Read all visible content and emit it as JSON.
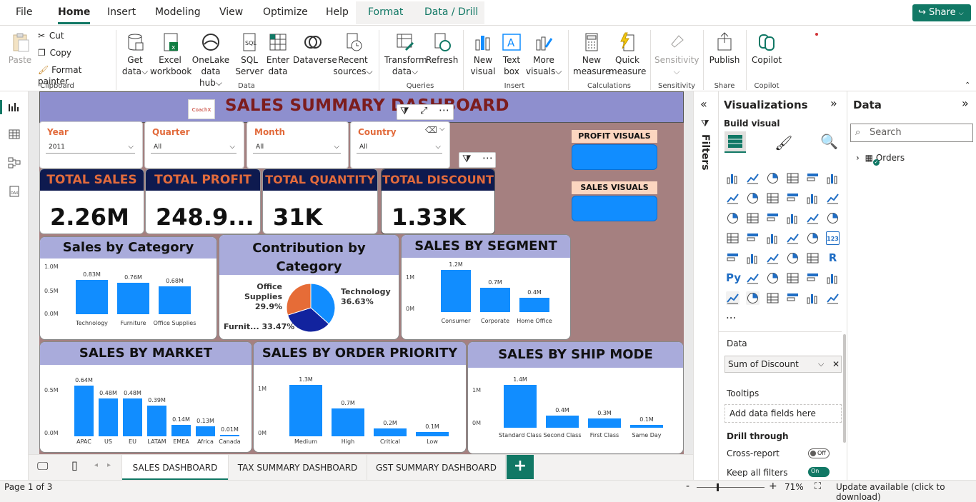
{
  "menu": {
    "tabs": [
      "File",
      "Home",
      "Insert",
      "Modeling",
      "View",
      "Optimize",
      "Help",
      "Format",
      "Data / Drill"
    ],
    "share_label": "Share"
  },
  "ribbon": {
    "clipboard": {
      "paste": "Paste",
      "cut": "Cut",
      "copy": "Copy",
      "format_painter": "Format painter",
      "group": "Clipboard"
    },
    "data": {
      "get_data": [
        "Get",
        "data"
      ],
      "excel": [
        "Excel",
        "workbook"
      ],
      "onelake": [
        "OneLake",
        "data hub"
      ],
      "sql": [
        "SQL",
        "Server"
      ],
      "enter": [
        "Enter",
        "data"
      ],
      "dataverse": "Dataverse",
      "recent": [
        "Recent",
        "sources"
      ],
      "group": "Data"
    },
    "queries": {
      "transform": [
        "Transform",
        "data"
      ],
      "refresh": "Refresh",
      "group": "Queries"
    },
    "insert": {
      "new_visual": [
        "New",
        "visual"
      ],
      "text_box": [
        "Text",
        "box"
      ],
      "more_visuals": [
        "More",
        "visuals"
      ],
      "group": "Insert"
    },
    "calculations": {
      "new_measure": [
        "New",
        "measure"
      ],
      "quick_measure": [
        "Quick",
        "measure"
      ],
      "group": "Calculations"
    },
    "sensitivity": {
      "label": "Sensitivity",
      "group": "Sensitivity"
    },
    "share": {
      "publish": "Publish",
      "group": "Share"
    },
    "copilot": {
      "label": "Copilot",
      "group": "Copilot"
    }
  },
  "report": {
    "title": "SALES SUMMARY DASHBOARD",
    "logo_text": "CoachX",
    "slicers": [
      {
        "label": "Year",
        "value": "2011"
      },
      {
        "label": "Quarter",
        "value": "All"
      },
      {
        "label": "Month",
        "value": "All"
      },
      {
        "label": "Country",
        "value": "All"
      }
    ],
    "kpis": [
      {
        "label": "TOTAL SALES",
        "value": "2.26M"
      },
      {
        "label": "TOTAL PROFIT",
        "value": "248.9..."
      },
      {
        "label": "TOTAL QUANTITY",
        "value": "31K"
      },
      {
        "label": "TOTAL DISCOUNT",
        "value": "1.33K"
      }
    ],
    "nav": {
      "profit_label": "PROFIT VISUALS",
      "sales_label": "SALES VISUALS"
    }
  },
  "chart_data": [
    {
      "type": "bar",
      "title": "Sales by Category",
      "categories": [
        "Technology",
        "Furniture",
        "Office Supplies"
      ],
      "values": [
        0.83,
        0.76,
        0.68
      ],
      "labels": [
        "0.83M",
        "0.76M",
        "0.68M"
      ],
      "yticks": [
        "1.0M",
        "0.5M",
        "0.0M"
      ],
      "ylim": [
        0,
        1.0
      ]
    },
    {
      "type": "pie",
      "title": "Contribution by Category",
      "slices": [
        {
          "name": "Technology",
          "pct": 36.63,
          "color": "#118dff"
        },
        {
          "name": "Furnit...",
          "pct": 33.47,
          "color": "#12239e"
        },
        {
          "name": "Office Supplies",
          "pct": 29.9,
          "color": "#e66c37"
        }
      ],
      "labels": [
        "Technology",
        "36.63%",
        "Furnit... 33.47%",
        "Office Supplies",
        "29.9%"
      ]
    },
    {
      "type": "bar",
      "title": "SALES BY SEGMENT",
      "categories": [
        "Consumer",
        "Corporate",
        "Home Office"
      ],
      "values": [
        1.2,
        0.7,
        0.4
      ],
      "labels": [
        "1.2M",
        "0.7M",
        "0.4M"
      ],
      "yticks": [
        "1M",
        "0M"
      ],
      "ylim": [
        0,
        1.3
      ]
    },
    {
      "type": "bar",
      "title": "SALES BY MARKET",
      "categories": [
        "APAC",
        "US",
        "EU",
        "LATAM",
        "EMEA",
        "Africa",
        "Canada"
      ],
      "values": [
        0.64,
        0.48,
        0.48,
        0.39,
        0.14,
        0.13,
        0.01
      ],
      "labels": [
        "0.64M",
        "0.48M",
        "0.48M",
        "0.39M",
        "0.14M",
        "0.13M",
        "0.01M"
      ],
      "yticks": [
        "0.5M",
        "0.0M"
      ],
      "ylim": [
        0,
        0.7
      ]
    },
    {
      "type": "bar",
      "title": "SALES BY ORDER PRIORITY",
      "categories": [
        "Medium",
        "High",
        "Critical",
        "Low"
      ],
      "values": [
        1.3,
        0.7,
        0.2,
        0.1
      ],
      "labels": [
        "1.3M",
        "0.7M",
        "0.2M",
        "0.1M"
      ],
      "yticks": [
        "1M",
        "0M"
      ],
      "ylim": [
        0,
        1.45
      ]
    },
    {
      "type": "bar",
      "title": "SALES BY SHIP MODE",
      "categories": [
        "Standard Class",
        "Second Class",
        "First Class",
        "Same Day"
      ],
      "values": [
        1.4,
        0.4,
        0.3,
        0.1
      ],
      "labels": [
        "1.4M",
        "0.4M",
        "0.3M",
        "0.1M"
      ],
      "yticks": [
        "1M",
        "0M"
      ],
      "ylim": [
        0,
        1.55
      ]
    }
  ],
  "filters_pane": {
    "label": "Filters"
  },
  "viz_pane": {
    "title": "Visualizations",
    "build_visual": "Build visual",
    "data_label": "Data",
    "field_value": "Sum of Discount",
    "tooltips_label": "Tooltips",
    "tooltips_placeholder": "Add data fields here",
    "drill_label": "Drill through",
    "cross_report": "Cross-report",
    "cross_report_state": "Off",
    "keep_filters": "Keep all filters",
    "keep_filters_state": "On",
    "more": "...",
    "letter_r": "R",
    "letter_py": "Py",
    "letter_123": "123"
  },
  "data_pane": {
    "title": "Data",
    "search_placeholder": "Search",
    "table": "Orders"
  },
  "pages": {
    "tabs": [
      "SALES DASHBOARD",
      "TAX SUMMARY DASHBOARD",
      "GST SUMMARY DASHBOARD"
    ],
    "add": "+"
  },
  "status": {
    "page": "Page 1 of 3",
    "zoom": "71%",
    "zoom_minus": "-",
    "zoom_plus": "+",
    "update": "Update available (click to download)"
  },
  "colors": {
    "accent": "#117865",
    "bar": "#118dff",
    "kpi_header": "#0e1a4f",
    "kpi_text": "#e26b3c",
    "title_text": "#7c1d1d",
    "header_band": "#8e8fce",
    "card_header": "#a9abdb",
    "canvas": "#a58080"
  }
}
